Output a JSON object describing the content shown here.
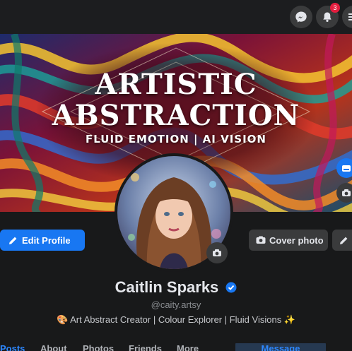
{
  "topbar": {
    "messenger_icon": "messenger-icon",
    "notifications_icon": "bell-icon",
    "notifications_count": "3",
    "menu_icon": "menu-icon"
  },
  "cover": {
    "title_line1": "ARTISTIC",
    "title_line2": "ABSTRACTION",
    "subtitle": "FLUID EMOTION | AI VISION"
  },
  "actions": {
    "edit_profile": "Edit Profile",
    "cover_photo": "Cover photo",
    "message": "Message"
  },
  "profile": {
    "name": "Caitlin Sparks",
    "verified": true,
    "handle": "@caity.artsy",
    "bio": "🎨 Art Abstract Creator | Colour Explorer | Fluid Visions ✨"
  },
  "tabs": [
    "Posts",
    "About",
    "Photos",
    "Friends",
    "More"
  ],
  "colors": {
    "accent": "#1877f2",
    "background": "#18191a",
    "surface": "#3a3b3c",
    "badge": "#e41e3f"
  }
}
